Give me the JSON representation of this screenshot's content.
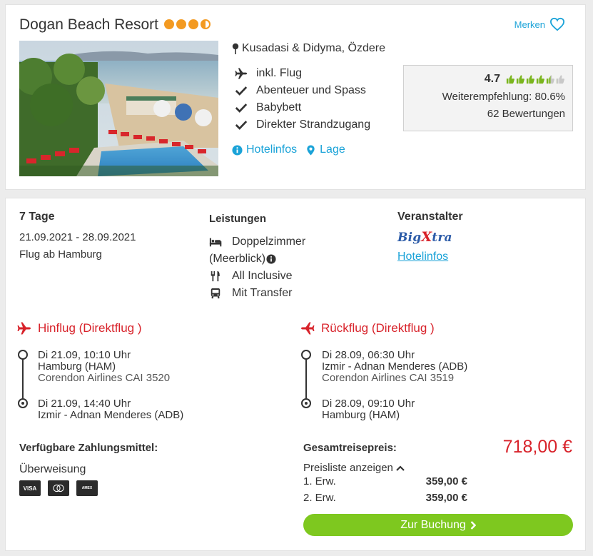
{
  "hotel": {
    "name": "Dogan Beach Resort",
    "star_rating": 3.5,
    "merken_label": "Merken",
    "location": "Kusadasi & Didyma, Özdere",
    "features": [
      {
        "icon": "plane-icon",
        "label": "inkl. Flug"
      },
      {
        "icon": "check-icon",
        "label": "Abenteuer und Spass"
      },
      {
        "icon": "check-icon",
        "label": "Babybett"
      },
      {
        "icon": "check-icon",
        "label": "Direkter Strandzugang"
      }
    ],
    "link_hotelinfos": "Hotelinfos",
    "link_lage": "Lage",
    "rating": {
      "score": "4.7",
      "thumbs_filled": 4.5,
      "thumbs_total": 6,
      "recommendation": "Weiterempfehlung: 80.6%",
      "reviews": "62 Bewertungen"
    }
  },
  "trip": {
    "duration": "7 Tage",
    "dates": "21.09.2021 - 28.09.2021",
    "departure": "Flug ab Hamburg",
    "services_title": "Leistungen",
    "services": [
      {
        "icon": "bed-icon",
        "label": "Doppelzimmer",
        "extra": "(Meerblick)"
      },
      {
        "icon": "cutlery-icon",
        "label": "All Inclusive"
      },
      {
        "icon": "bus-icon",
        "label": "Mit Transfer"
      }
    ],
    "operator_title": "Veranstalter",
    "operator_logo_a": "Big",
    "operator_logo_b": "X",
    "operator_logo_c": "tra",
    "operator_link": "Hotelinfos",
    "outbound": {
      "title": "Hinflug (Direktflug )",
      "dep_time": "Di 21.09, 10:10 Uhr",
      "dep_airport": "Hamburg (HAM)",
      "airline": "Corendon Airlines CAI 3520",
      "arr_time": "Di 21.09, 14:40 Uhr",
      "arr_airport": "Izmir - Adnan Menderes (ADB)"
    },
    "return": {
      "title": "Rückflug (Direktflug )",
      "dep_time": "Di 28.09, 06:30 Uhr",
      "dep_airport": "Izmir - Adnan Menderes (ADB)",
      "airline": "Corendon Airlines CAI 3519",
      "arr_time": "Di 28.09, 09:10 Uhr",
      "arr_airport": "Hamburg (HAM)"
    },
    "payment_title": "Verfügbare Zahlungsmittel:",
    "payment_transfer": "Überweisung",
    "payment_cards": [
      "VISA",
      "mastercard",
      "AMEX"
    ],
    "total_title": "Gesamtreisepreis:",
    "total_price": "718,00 €",
    "price_list_label": "Preisliste anzeigen",
    "price_rows": [
      {
        "label": "1. Erw.",
        "amount": "359,00 €"
      },
      {
        "label": "2. Erw.",
        "amount": "359,00 €"
      }
    ],
    "book_label": "Zur Buchung"
  },
  "colors": {
    "accent_blue": "#1ba3d8",
    "star_orange": "#f39a21",
    "price_red": "#d8222a",
    "button_green": "#7ec81f",
    "thumb_green": "#7ab51d"
  }
}
